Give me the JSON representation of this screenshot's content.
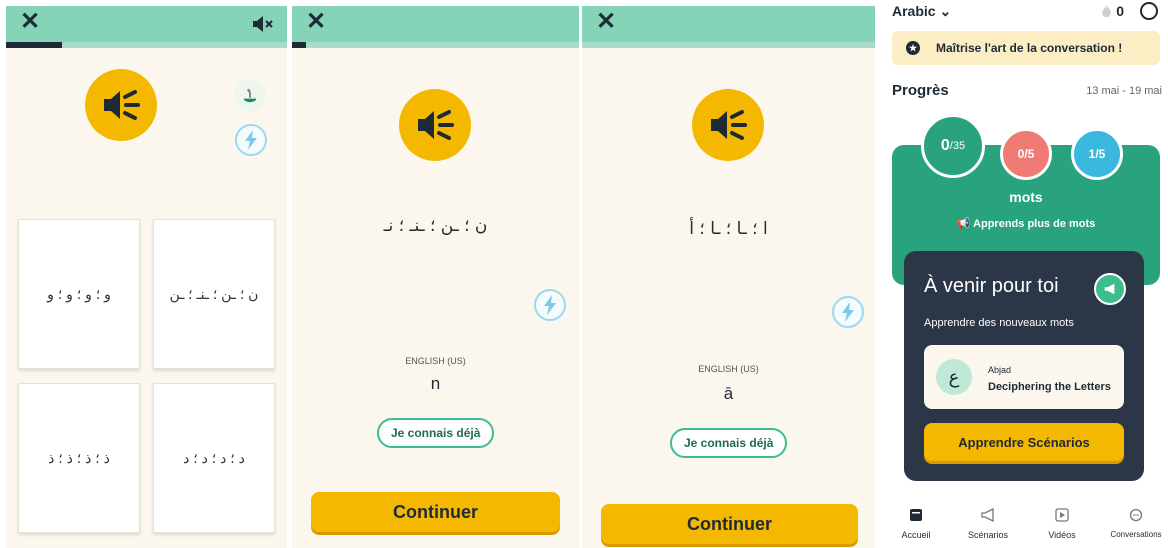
{
  "panel1": {
    "close_icon": "close-icon",
    "mute_icon": "mute-icon",
    "progress": 0.2,
    "cards": [
      "و ؛ و ؛ و ؛ و",
      "ن ؛ ـن ؛ ـنـ ؛ ـن",
      "ذ ؛ ذ ؛ ذ ؛ ذ",
      "د ؛ د ؛ د ؛ د"
    ]
  },
  "panel2": {
    "progress": 0.05,
    "arabic": "ن ؛ ـن ؛ ـنـ ؛ نـ",
    "lang_label": "ENGLISH (US)",
    "translit": "n",
    "know_label": "Je connais déjà",
    "continue_label": "Continuer"
  },
  "panel3": {
    "progress": 0,
    "arabic": "ا ؛ ـا ؛ ـا ؛ أ",
    "lang_label": "ENGLISH (US)",
    "translit": "ā",
    "know_label": "Je connais déjà",
    "continue_label": "Continuer"
  },
  "panel4": {
    "language": "Arabic",
    "streak": "0",
    "banner": "Maîtrise l'art de la conversation !",
    "progress_title": "Progrès",
    "dates": "13 mai - 19 mai",
    "stats": [
      {
        "value": "0",
        "total": "/35"
      },
      {
        "value": "0/5"
      },
      {
        "value": "1/5"
      }
    ],
    "mots": "mots",
    "learn_more": "Apprends plus de mots",
    "upcoming_title": "À venir pour toi",
    "upcoming_sub": "Apprendre des nouveaux mots",
    "course_letter": "ع",
    "course_label": "Abjad",
    "course_title": "Deciphering the Letters",
    "cta": "Apprendre Scénarios",
    "nav": [
      {
        "label": "Accueil",
        "icon": "home-icon"
      },
      {
        "label": "Scénarios",
        "icon": "megaphone-icon"
      },
      {
        "label": "Vidéos",
        "icon": "video-icon"
      },
      {
        "label": "Conversations",
        "icon": "chat-icon"
      }
    ],
    "colors": {
      "green": "#28a37e",
      "dark": "#2b3646",
      "yellow": "#f5b800",
      "red": "#f07a74",
      "blue": "#3bb8dd"
    }
  }
}
